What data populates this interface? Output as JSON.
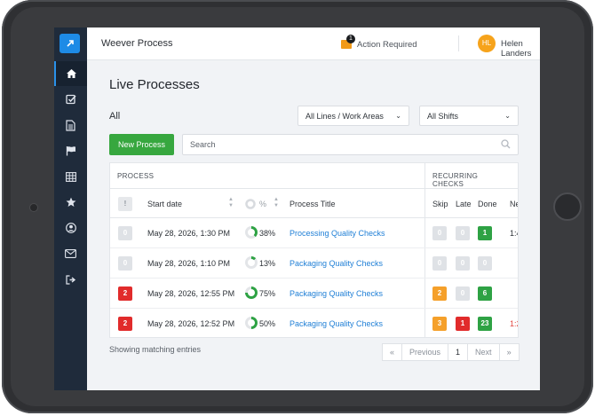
{
  "app": {
    "title": "Weever Process"
  },
  "header": {
    "action_count": "1",
    "action_label": "Action Required",
    "user_initials": "HL",
    "user_name": "Helen Landers"
  },
  "sidebar": {
    "items": [
      {
        "icon": "home-icon",
        "active": true
      },
      {
        "icon": "checkbox-icon"
      },
      {
        "icon": "document-icon"
      },
      {
        "icon": "flag-icon"
      },
      {
        "icon": "table-icon"
      },
      {
        "icon": "star-icon"
      },
      {
        "icon": "user-icon"
      },
      {
        "icon": "mail-icon"
      },
      {
        "icon": "sign-out-icon"
      }
    ]
  },
  "main": {
    "title": "Live Processes",
    "filter_label": "All",
    "lines_select": "All Lines / Work Areas",
    "shifts_select": "All Shifts",
    "new_button": "New Process",
    "search_placeholder": "Search"
  },
  "table": {
    "group_process": "PROCESS",
    "group_recurring": "RECURRING CHECKS",
    "columns": {
      "flag": "!",
      "start_date": "Start date",
      "percent": "%",
      "title": "Process Title",
      "skip": "Skip",
      "late": "Late",
      "done": "Done",
      "next": "Ne"
    },
    "rows": [
      {
        "flag": "0",
        "start": "May 28, 2026, 1:30 PM",
        "pct": "38%",
        "pct_value": 38,
        "title": "Processing Quality Checks",
        "skip": "0",
        "late": "0",
        "done": "1",
        "next": "1:4"
      },
      {
        "flag": "0",
        "start": "May 28, 2026, 1:10 PM",
        "pct": "13%",
        "pct_value": 13,
        "title": "Packaging Quality Checks",
        "skip": "0",
        "late": "0",
        "done": "0",
        "next": ""
      },
      {
        "flag": "2",
        "start": "May 28, 2026, 12:55 PM",
        "pct": "75%",
        "pct_value": 75,
        "title": "Packaging Quality Checks",
        "skip": "2",
        "late": "0",
        "done": "6",
        "next": ""
      },
      {
        "flag": "2",
        "start": "May 28, 2026, 12:52 PM",
        "pct": "50%",
        "pct_value": 50,
        "title": "Packaging Quality Checks",
        "skip": "3",
        "late": "1",
        "done": "23",
        "next": "1:2"
      }
    ]
  },
  "footer": {
    "info": "Showing matching entries",
    "pager": {
      "first": "«",
      "prev": "Previous",
      "page": "1",
      "next": "Next",
      "last": "»"
    }
  },
  "colors": {
    "accent": "#1f7fd6",
    "green": "#2ea244",
    "red": "#e12b2b",
    "orange": "#f5a02a",
    "sidebar": "#1f2b3b"
  }
}
